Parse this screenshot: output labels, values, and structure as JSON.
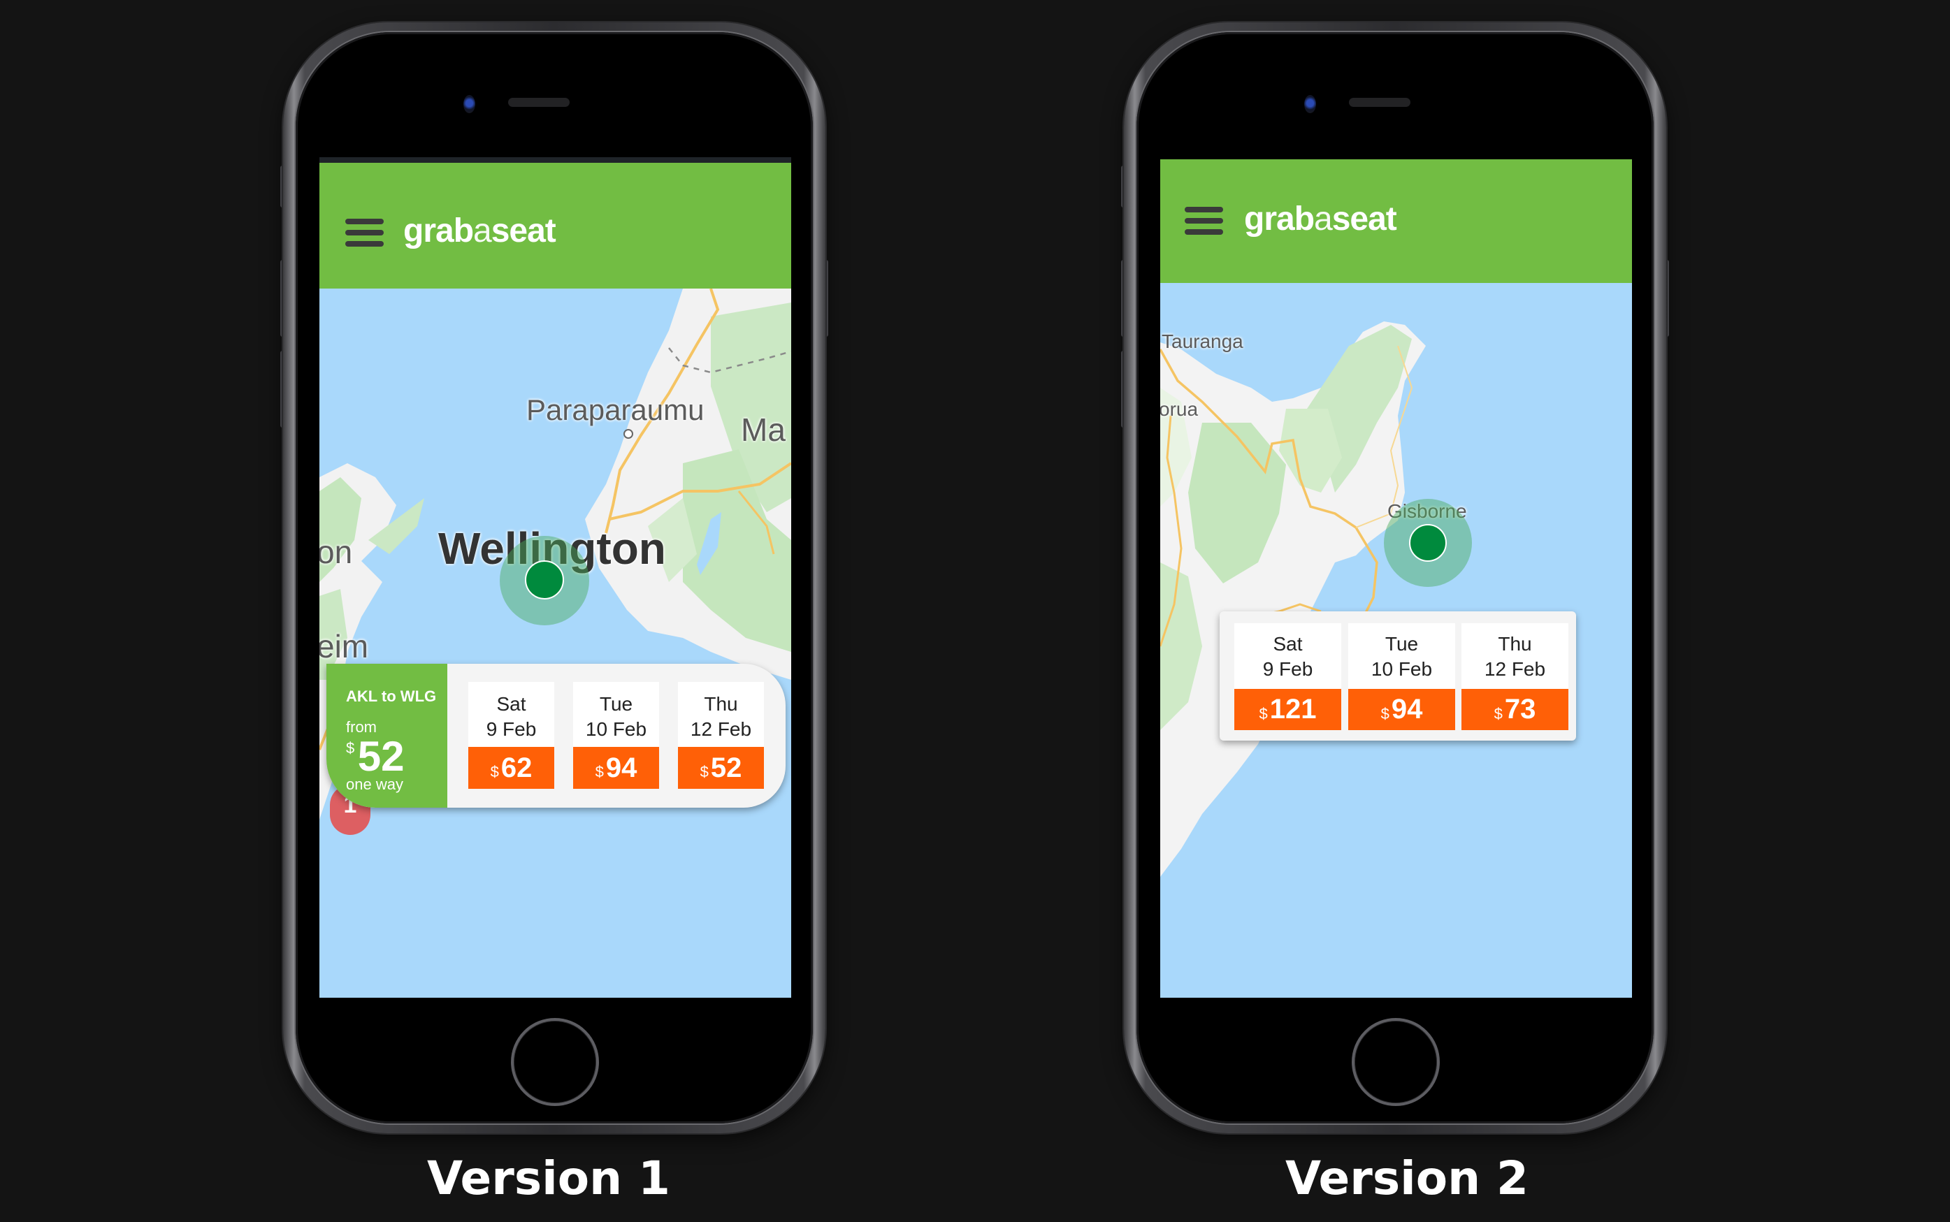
{
  "versions": [
    {
      "caption": "Version 1",
      "app": {
        "logo_part1": "grab",
        "logo_part2": "a",
        "logo_part3": "seat",
        "menu_icon": "hamburger-menu-icon"
      },
      "map": {
        "labels": [
          "Paraparaumu",
          "Ma",
          "Wellington",
          "on",
          "eim"
        ],
        "marker_label": "1"
      },
      "route_panel": {
        "route": "AKL to WLG",
        "from_label": "from",
        "currency": "$",
        "price": "52",
        "trip_type": "one way"
      },
      "dates": [
        {
          "day": "Sat",
          "date": "9 Feb",
          "currency": "$",
          "price": "62"
        },
        {
          "day": "Tue",
          "date": "10 Feb",
          "currency": "$",
          "price": "94"
        },
        {
          "day": "Thu",
          "date": "12 Feb",
          "currency": "$",
          "price": "52"
        }
      ]
    },
    {
      "caption": "Version 2",
      "app": {
        "logo_part1": "grab",
        "logo_part2": "a",
        "logo_part3": "seat",
        "menu_icon": "hamburger-menu-icon"
      },
      "map": {
        "labels": [
          "Tauranga",
          "orua",
          "Gisborne"
        ]
      },
      "dates": [
        {
          "day": "Sat",
          "date": "9 Feb",
          "currency": "$",
          "price": "121"
        },
        {
          "day": "Tue",
          "date": "10 Feb",
          "currency": "$",
          "price": "94"
        },
        {
          "day": "Thu",
          "date": "12 Feb",
          "currency": "$",
          "price": "73"
        }
      ]
    }
  ],
  "colors": {
    "brand_green": "#72bd43",
    "price_orange": "#ff6007",
    "sea_blue": "#a9d8fb",
    "pin_green": "#008a3d"
  }
}
